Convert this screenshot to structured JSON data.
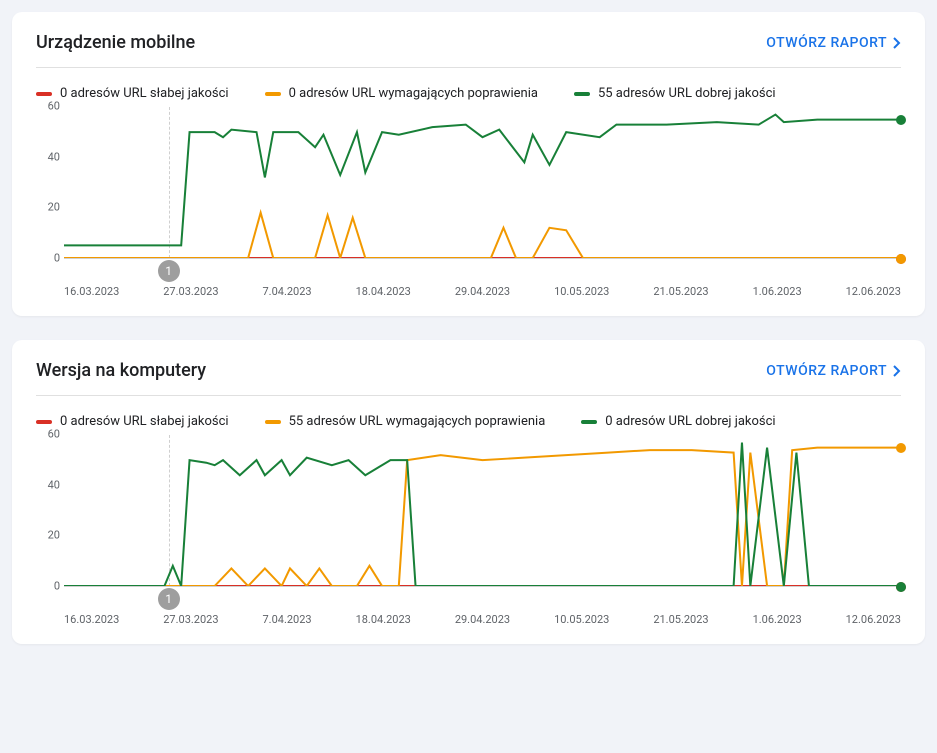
{
  "colors": {
    "poor": "#d93025",
    "need": "#f29900",
    "good": "#188038"
  },
  "translations": {
    "open_report": "OTWÓRZ RAPORT"
  },
  "panels": [
    {
      "title": "Urządzenie mobilne",
      "legend": {
        "poor": "0 adresów URL słabej jakości",
        "need": "0 adresów URL wymagających poprawienia",
        "good": "55 adresów URL dobrej jakości"
      },
      "marker": {
        "label": "1",
        "date": "27.03.2023"
      }
    },
    {
      "title": "Wersja na komputery",
      "legend": {
        "poor": "0 adresów URL słabej jakości",
        "need": "55 adresów URL wymagających poprawienia",
        "good": "0 adresów URL dobrej jakości"
      },
      "marker": {
        "label": "1",
        "date": "27.03.2023"
      }
    }
  ],
  "chart_data": [
    {
      "type": "line",
      "title": "Urządzenie mobilne",
      "ylabel": "",
      "xlabel": "",
      "ylim": [
        0,
        60
      ],
      "x": [
        "16.03.2023",
        "27.03.2023",
        "7.04.2023",
        "18.04.2023",
        "29.04.2023",
        "10.05.2023",
        "21.05.2023",
        "1.06.2023",
        "12.06.2023"
      ],
      "y_ticks": [
        0,
        20,
        40,
        60
      ],
      "marker_at": "27.03.2023",
      "series": [
        {
          "name": "poor",
          "color": "#d93025",
          "values": [
            [
              0,
              0
            ],
            [
              100,
              0
            ]
          ],
          "end_value": 0
        },
        {
          "name": "need",
          "color": "#f29900",
          "values": [
            [
              0,
              0
            ],
            [
              22,
              0
            ],
            [
              23.5,
              18
            ],
            [
              25,
              0
            ],
            [
              30,
              0
            ],
            [
              31.5,
              17
            ],
            [
              33,
              0
            ],
            [
              34.5,
              16
            ],
            [
              36,
              0
            ],
            [
              51,
              0
            ],
            [
              52.5,
              12
            ],
            [
              54,
              0
            ],
            [
              56,
              0
            ],
            [
              58,
              12
            ],
            [
              60,
              11
            ],
            [
              62,
              0
            ],
            [
              100,
              0
            ]
          ],
          "end_value": 0
        },
        {
          "name": "good",
          "color": "#188038",
          "values": [
            [
              0,
              5
            ],
            [
              14,
              5
            ],
            [
              15,
              50
            ],
            [
              18,
              50
            ],
            [
              19,
              48
            ],
            [
              20,
              51
            ],
            [
              23,
              50
            ],
            [
              24,
              32
            ],
            [
              25,
              50
            ],
            [
              28,
              50
            ],
            [
              30,
              44
            ],
            [
              31,
              49
            ],
            [
              33,
              33
            ],
            [
              35,
              50
            ],
            [
              36,
              34
            ],
            [
              38,
              50
            ],
            [
              40,
              49
            ],
            [
              44,
              52
            ],
            [
              48,
              53
            ],
            [
              50,
              48
            ],
            [
              52,
              51
            ],
            [
              55,
              38
            ],
            [
              56,
              49
            ],
            [
              58,
              37
            ],
            [
              60,
              50
            ],
            [
              64,
              48
            ],
            [
              66,
              53
            ],
            [
              72,
              53
            ],
            [
              78,
              54
            ],
            [
              83,
              53
            ],
            [
              85,
              57
            ],
            [
              86,
              54
            ],
            [
              90,
              55
            ],
            [
              100,
              55
            ]
          ],
          "end_value": 55
        }
      ]
    },
    {
      "type": "line",
      "title": "Wersja na komputery",
      "ylabel": "",
      "xlabel": "",
      "ylim": [
        0,
        60
      ],
      "x": [
        "16.03.2023",
        "27.03.2023",
        "7.04.2023",
        "18.04.2023",
        "29.04.2023",
        "10.05.2023",
        "21.05.2023",
        "1.06.2023",
        "12.06.2023"
      ],
      "y_ticks": [
        0,
        20,
        40,
        60
      ],
      "marker_at": "27.03.2023",
      "series": [
        {
          "name": "poor",
          "color": "#d93025",
          "values": [
            [
              0,
              0
            ],
            [
              100,
              0
            ]
          ],
          "end_value": 0
        },
        {
          "name": "need",
          "color": "#f29900",
          "values": [
            [
              0,
              0
            ],
            [
              18,
              0
            ],
            [
              20,
              7
            ],
            [
              22,
              0
            ],
            [
              24,
              7
            ],
            [
              26,
              0
            ],
            [
              27,
              7
            ],
            [
              29,
              0
            ],
            [
              30.5,
              7
            ],
            [
              32,
              0
            ],
            [
              35,
              0
            ],
            [
              36.5,
              8
            ],
            [
              38,
              0
            ],
            [
              40,
              0
            ],
            [
              41,
              50
            ],
            [
              45,
              52
            ],
            [
              50,
              50
            ],
            [
              55,
              51
            ],
            [
              60,
              52
            ],
            [
              65,
              53
            ],
            [
              70,
              54
            ],
            [
              75,
              54
            ],
            [
              80,
              53
            ],
            [
              81,
              0
            ],
            [
              82,
              53
            ],
            [
              84,
              0
            ],
            [
              86,
              0
            ],
            [
              87,
              54
            ],
            [
              90,
              55
            ],
            [
              100,
              55
            ]
          ],
          "end_value": 55
        },
        {
          "name": "good",
          "color": "#188038",
          "values": [
            [
              0,
              0
            ],
            [
              12,
              0
            ],
            [
              13,
              8
            ],
            [
              14,
              0
            ],
            [
              15,
              50
            ],
            [
              17,
              49
            ],
            [
              18,
              48
            ],
            [
              19,
              50
            ],
            [
              21,
              44
            ],
            [
              23,
              50
            ],
            [
              24,
              44
            ],
            [
              26,
              50
            ],
            [
              27,
              44
            ],
            [
              29,
              51
            ],
            [
              32,
              48
            ],
            [
              34,
              50
            ],
            [
              36,
              44
            ],
            [
              39,
              50
            ],
            [
              41,
              50
            ],
            [
              42,
              0
            ],
            [
              80,
              0
            ],
            [
              81,
              57
            ],
            [
              82,
              0
            ],
            [
              84,
              55
            ],
            [
              86,
              0
            ],
            [
              87.5,
              53
            ],
            [
              89,
              0
            ],
            [
              100,
              0
            ]
          ],
          "end_value": 0
        }
      ]
    }
  ]
}
